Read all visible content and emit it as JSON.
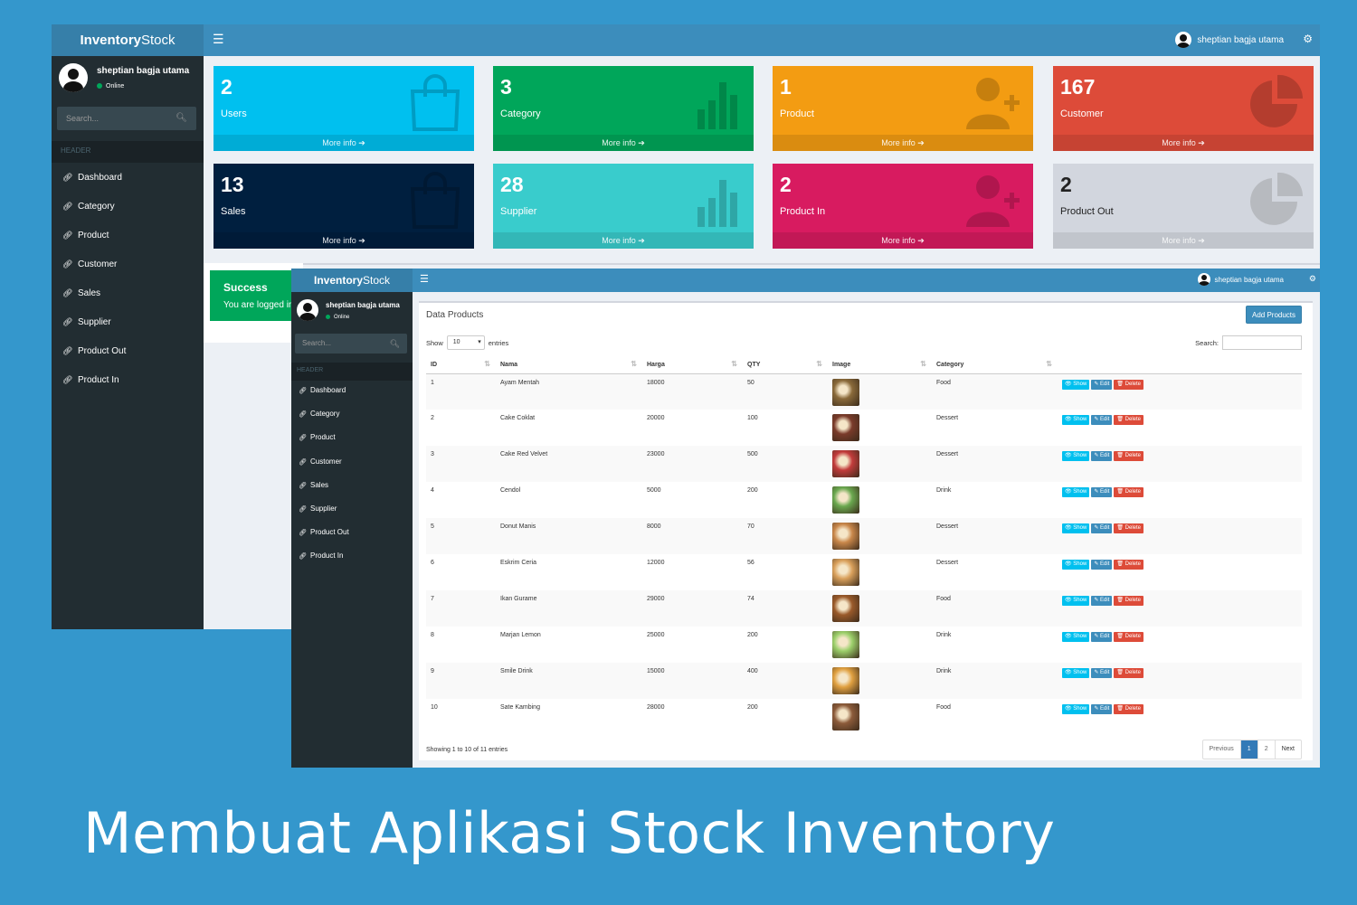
{
  "back_window": {
    "logo_bold": "Inventory",
    "logo_light": "Stock",
    "user_name": "sheptian bagja utama",
    "sidebar": {
      "user_name": "sheptian bagja utama",
      "status": "Online",
      "search_placeholder": "Search...",
      "header": "HEADER",
      "items": [
        "Dashboard",
        "Category",
        "Product",
        "Customer",
        "Sales",
        "Supplier",
        "Product Out",
        "Product In"
      ]
    },
    "tiles": [
      {
        "value": "2",
        "label": "Users",
        "more": "More info",
        "color": "#00c0ef",
        "icon": "shopping-bag-icon"
      },
      {
        "value": "3",
        "label": "Category",
        "more": "More info",
        "color": "#00a65a",
        "icon": "bar-chart-icon"
      },
      {
        "value": "1",
        "label": "Product",
        "more": "More info",
        "color": "#f39c12",
        "icon": "user-plus-icon"
      },
      {
        "value": "167",
        "label": "Customer",
        "more": "More info",
        "color": "#dd4b39",
        "icon": "pie-chart-icon"
      },
      {
        "value": "13",
        "label": "Sales",
        "more": "More info",
        "color": "#001f3f",
        "icon": "shopping-bag-icon"
      },
      {
        "value": "28",
        "label": "Supplier",
        "more": "More info",
        "color": "#39cccc",
        "icon": "bar-chart-icon"
      },
      {
        "value": "2",
        "label": "Product In",
        "more": "More info",
        "color": "#d81b60",
        "icon": "user-plus-icon"
      },
      {
        "value": "2",
        "label": "Product Out",
        "more": "More info",
        "color": "#d2d6de",
        "icon": "pie-chart-icon"
      }
    ],
    "alert": {
      "title": "Success",
      "message": "You are logged in!"
    }
  },
  "front_window": {
    "logo_bold": "Inventory",
    "logo_light": "Stock",
    "user_name": "sheptian bagja utama",
    "sidebar": {
      "user_name": "sheptian bagja utama",
      "status": "Online",
      "search_placeholder": "Search...",
      "header": "HEADER",
      "items": [
        "Dashboard",
        "Category",
        "Product",
        "Customer",
        "Sales",
        "Supplier",
        "Product Out",
        "Product In"
      ]
    },
    "box_title": "Data Products",
    "add_button": "Add Products",
    "show_label": "Show",
    "show_value": "10",
    "entries_label": "entries",
    "search_label": "Search:",
    "columns": [
      "ID",
      "Nama",
      "Harga",
      "QTY",
      "Image",
      "Category"
    ],
    "rows": [
      {
        "id": "1",
        "nama": "Ayam Mentah",
        "harga": "18000",
        "qty": "50",
        "category": "Food",
        "thumb": "#8a6a3a"
      },
      {
        "id": "2",
        "nama": "Cake Coklat",
        "harga": "20000",
        "qty": "100",
        "category": "Dessert",
        "thumb": "#7a3b2a"
      },
      {
        "id": "3",
        "nama": "Cake Red Velvet",
        "harga": "23000",
        "qty": "500",
        "category": "Dessert",
        "thumb": "#c23b3b"
      },
      {
        "id": "4",
        "nama": "Cendol",
        "harga": "5000",
        "qty": "200",
        "category": "Drink",
        "thumb": "#6aa84f"
      },
      {
        "id": "5",
        "nama": "Donut Manis",
        "harga": "8000",
        "qty": "70",
        "category": "Dessert",
        "thumb": "#c9874a"
      },
      {
        "id": "6",
        "nama": "Eskrim Ceria",
        "harga": "12000",
        "qty": "56",
        "category": "Dessert",
        "thumb": "#d9a05b"
      },
      {
        "id": "7",
        "nama": "Ikan Gurame",
        "harga": "29000",
        "qty": "74",
        "category": "Food",
        "thumb": "#9a5a2a"
      },
      {
        "id": "8",
        "nama": "Marjan Lemon",
        "harga": "25000",
        "qty": "200",
        "category": "Drink",
        "thumb": "#9bcf6a"
      },
      {
        "id": "9",
        "nama": "Smile Drink",
        "harga": "15000",
        "qty": "400",
        "category": "Drink",
        "thumb": "#e0a040"
      },
      {
        "id": "10",
        "nama": "Sate Kambing",
        "harga": "28000",
        "qty": "200",
        "category": "Food",
        "thumb": "#8c5b3a"
      }
    ],
    "actions": {
      "show": "Show",
      "edit": "Edit",
      "delete": "Delete"
    },
    "footer": "Showing 1 to 10 of 11 entries",
    "pager": [
      "Previous",
      "1",
      "2",
      "Next"
    ]
  },
  "caption": "Membuat Aplikasi Stock Inventory"
}
